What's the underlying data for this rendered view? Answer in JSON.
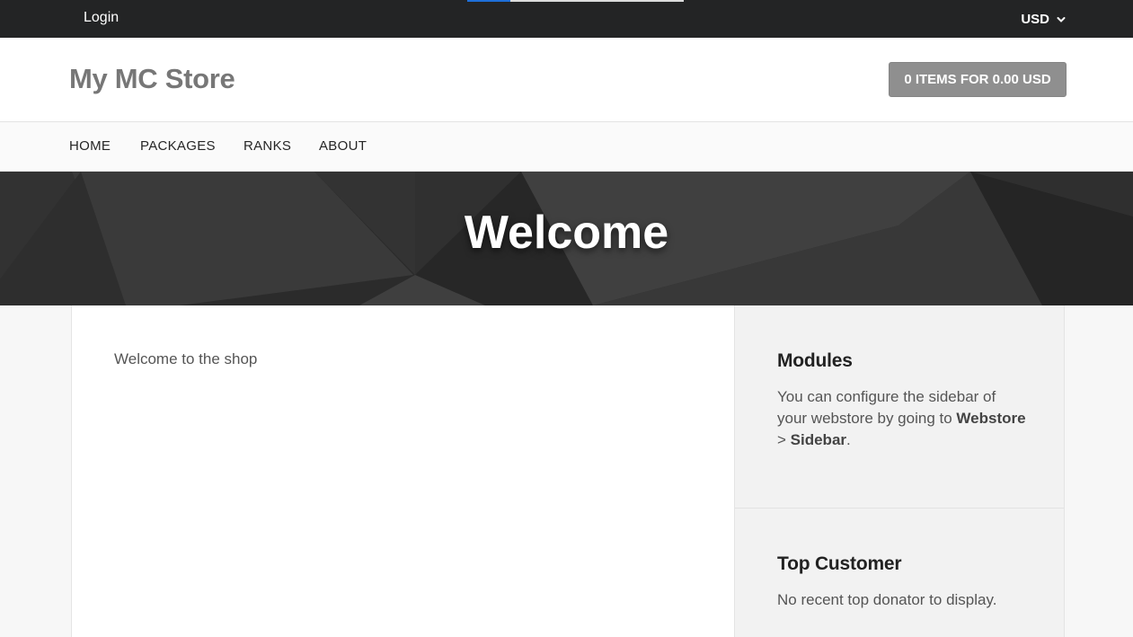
{
  "topbar": {
    "login_label": "Login",
    "currency": "USD",
    "loading_progress": 0.2
  },
  "header": {
    "store_name": "My MC Store",
    "cart_label": "0 ITEMS FOR 0.00 USD"
  },
  "nav": {
    "items": [
      {
        "label": "HOME"
      },
      {
        "label": "PACKAGES"
      },
      {
        "label": "RANKS"
      },
      {
        "label": "ABOUT"
      }
    ]
  },
  "hero": {
    "title": "Welcome"
  },
  "main": {
    "text": "Welcome to the shop"
  },
  "sidebar": {
    "modules": [
      {
        "title": "Modules",
        "text_before": "You can configure the sidebar of your webstore by going to ",
        "bold_1": "Webstore",
        "separator": " > ",
        "bold_2": "Sidebar",
        "text_after": "."
      },
      {
        "title": "Top Customer",
        "text": "No recent top donator to display."
      }
    ]
  },
  "colors": {
    "topbar_bg": "#232425",
    "cart_button_bg": "#8f8f8f",
    "progress_accent": "#1e6fd9"
  }
}
